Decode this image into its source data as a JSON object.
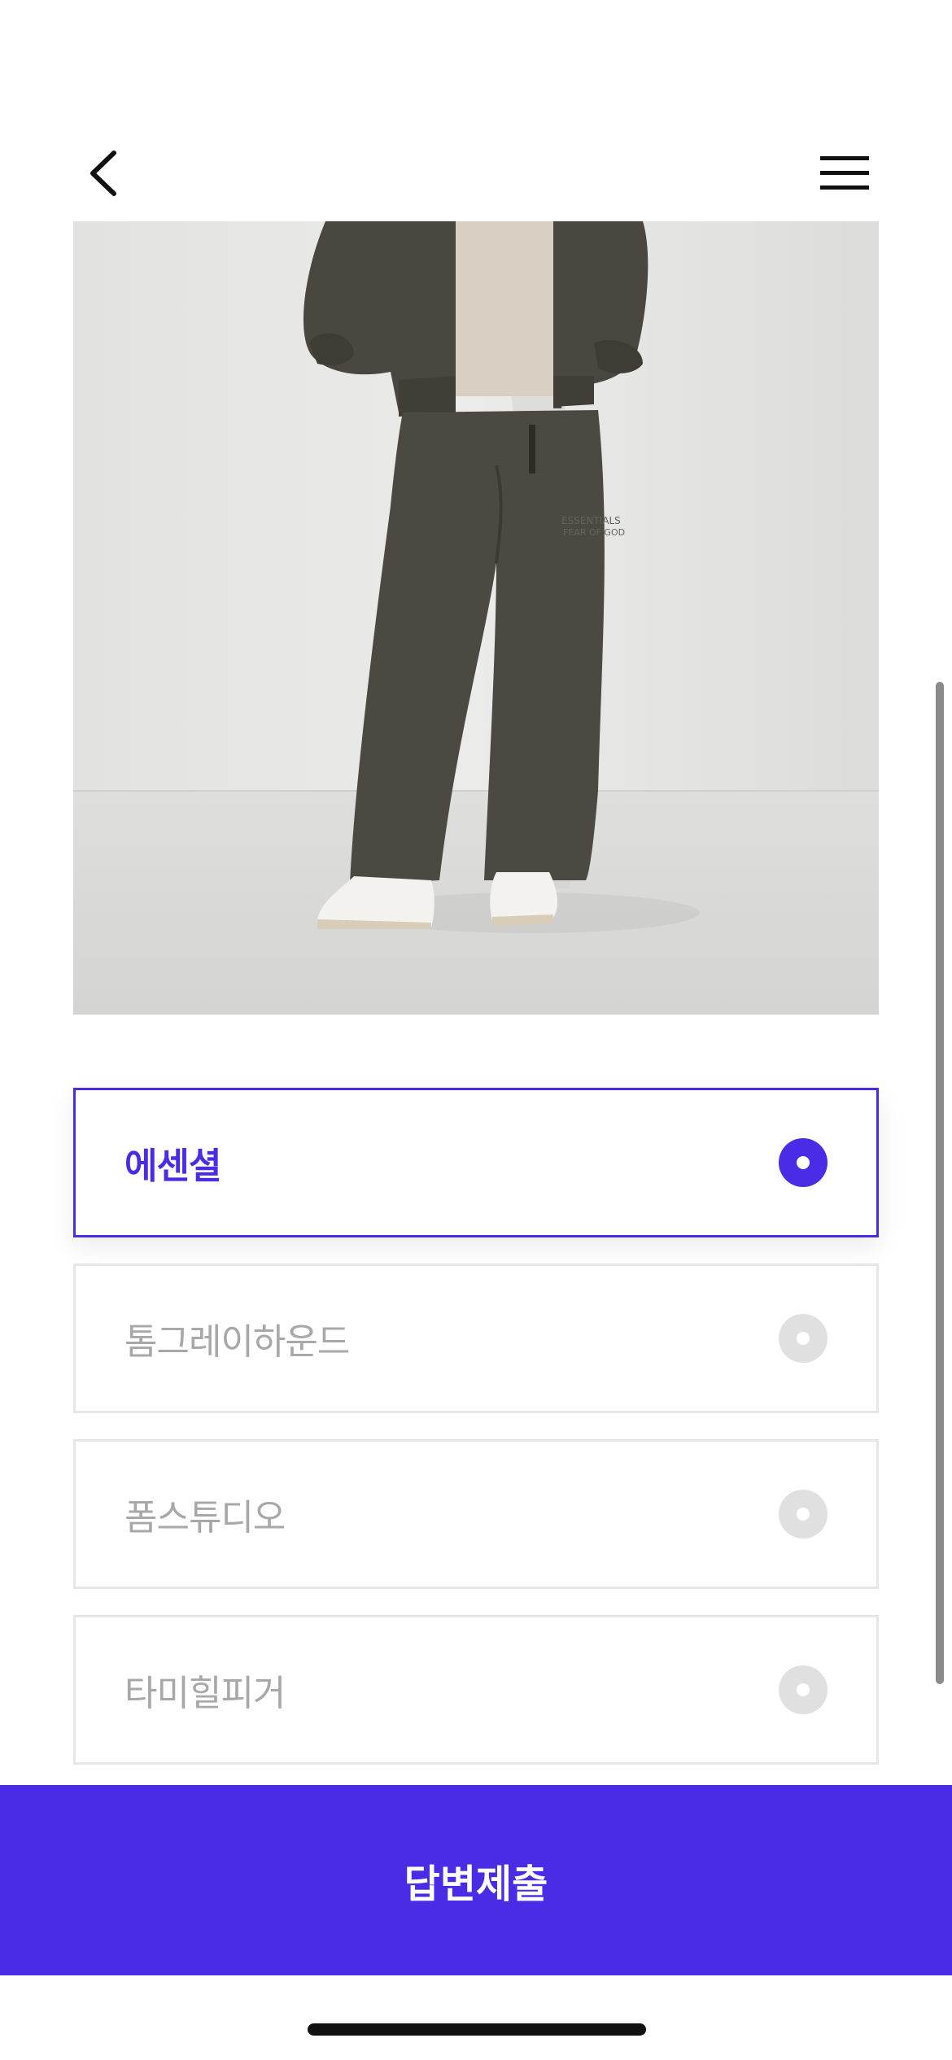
{
  "header": {
    "back_icon": "chevron-left-icon",
    "menu_icon": "hamburger-menu-icon"
  },
  "product_image": {
    "print_text_line1": "ESSENTIALS",
    "print_text_line2": "FEAR OF GOD"
  },
  "options": [
    {
      "label": "에센셜",
      "selected": true
    },
    {
      "label": "톰그레이하운드",
      "selected": false
    },
    {
      "label": "폼스튜디오",
      "selected": false
    },
    {
      "label": "타미힐피거",
      "selected": false
    }
  ],
  "submit": {
    "label": "답변제출"
  },
  "colors": {
    "accent": "#4a2be6",
    "unselected_text": "#a8a8a8",
    "border": "#e7e7e7"
  }
}
